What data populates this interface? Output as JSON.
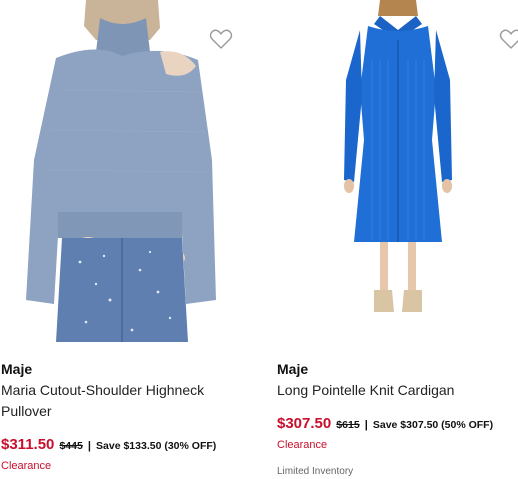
{
  "colors": {
    "sale_price": "#c8102e",
    "clearance": "#c8102e",
    "heart_outline": "#999999",
    "sweater": "#8ea3c2",
    "dress": "#1f6fd6"
  },
  "products": [
    {
      "image_alt": "",
      "icon": "heart-outline-icon",
      "brand": "Maje",
      "name": "Maria Cutout-Shoulder Highneck Pullover",
      "sale_price": "$311.50",
      "original_price": "$445",
      "separator": "|",
      "savings": "Save $133.50 (30% OFF)",
      "badge": "Clearance"
    },
    {
      "image_alt": "",
      "icon": "heart-outline-icon",
      "brand": "Maje",
      "name": "Long Pointelle Knit Cardigan",
      "sale_price": "$307.50",
      "original_price": "$615",
      "separator": "|",
      "savings": "Save $307.50 (50% OFF)",
      "badge": "Clearance",
      "inventory": "Limited Inventory"
    }
  ]
}
